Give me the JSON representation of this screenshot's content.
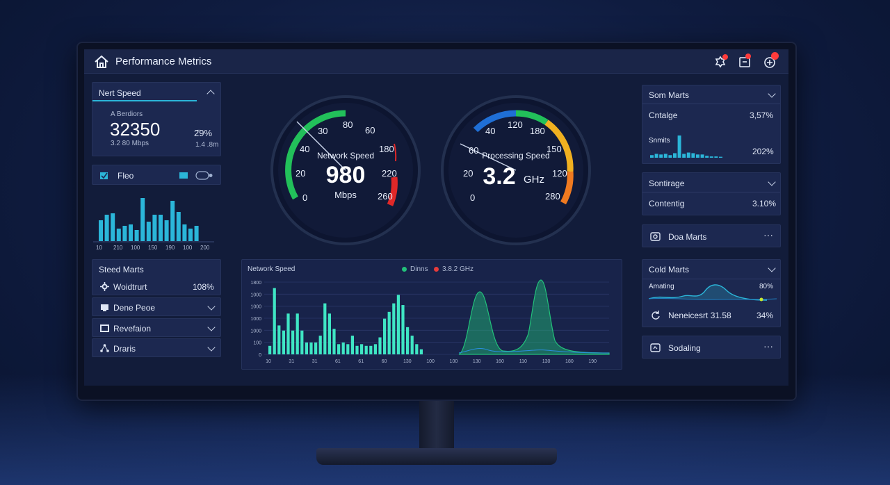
{
  "app": {
    "title": "Performance Metrics"
  },
  "left": {
    "speed_card": {
      "title": "Nert Speed",
      "sublabel": "A Berdiors",
      "value": "32350",
      "unit_line": "3.2 80 Mbps",
      "percent": "2̈9%",
      "sub_right": "1.4 .8m"
    },
    "fleo_card": {
      "label": "Fleo"
    },
    "histogram": {
      "values": [
        30,
        38,
        40,
        18,
        22,
        24,
        16,
        62,
        28,
        38,
        38,
        30,
        58,
        42,
        24,
        18,
        22
      ],
      "ticks": [
        "10",
        "210",
        "100",
        "150",
        "190",
        "100",
        "200"
      ]
    },
    "menu": {
      "title": "Steed Marts",
      "items": [
        {
          "label": "Woidtrurt",
          "value": "108%"
        },
        {
          "label": "Dene Peoe"
        },
        {
          "label": "Revefaion"
        },
        {
          "label": "Draris"
        }
      ]
    }
  },
  "gauges": [
    {
      "title": "Network Speed",
      "value": "980",
      "unit": "Mbps",
      "ticks": [
        "0",
        "20",
        "40",
        "30",
        "80",
        "60",
        "180",
        "220",
        "260"
      ]
    },
    {
      "title": "Processing Speed",
      "value": "3.2",
      "unit": "GHz",
      "ticks": [
        "0",
        "20",
        "60",
        "40",
        "120",
        "180",
        "150",
        "120",
        "280"
      ]
    }
  ],
  "chart_data": {
    "type": "bar",
    "title": "Network Speed",
    "legend": [
      {
        "name": "Dinns",
        "color": "#22c07a"
      },
      {
        "name": "3.8.2 GHz",
        "color": "#e63b3b"
      }
    ],
    "legend_position": "top",
    "y_ticks": [
      "0",
      "100",
      "1000",
      "1000",
      "1000",
      "1000",
      "1800"
    ],
    "x_ticks": [
      "10",
      "31",
      "31",
      "61",
      "61",
      "60",
      "130",
      "100",
      "100",
      "130",
      "160",
      "110",
      "130",
      "180",
      "190"
    ],
    "bar_values": [
      10,
      78,
      34,
      28,
      48,
      28,
      48,
      28,
      14,
      14,
      14,
      22,
      60,
      48,
      30,
      12,
      14,
      12,
      22,
      10,
      12,
      10,
      10,
      12,
      20,
      42,
      50,
      60,
      70,
      58,
      32,
      22,
      12,
      6
    ],
    "grid": true
  },
  "right": {
    "card1": {
      "title": "Som Marts",
      "row1_label": "Cntalge",
      "row1_value": "3,57%",
      "spark_label": "Snmits",
      "spark_value": "202%",
      "spark_values": [
        8,
        12,
        10,
        12,
        8,
        14,
        30,
        12,
        16,
        14,
        10,
        10,
        6,
        4,
        4,
        3
      ]
    },
    "card2": {
      "title": "Sontirage",
      "row_label": "Contentig",
      "row_value": "3.10%"
    },
    "card3": {
      "label": "Doa Marts"
    },
    "card4": {
      "title": "Cold Marts",
      "wave_label": "Amating",
      "wave_value": "80%",
      "row_label": "Neneicesrt 31.58",
      "row_value": "34%"
    },
    "card5": {
      "label": "Sodaling"
    }
  }
}
